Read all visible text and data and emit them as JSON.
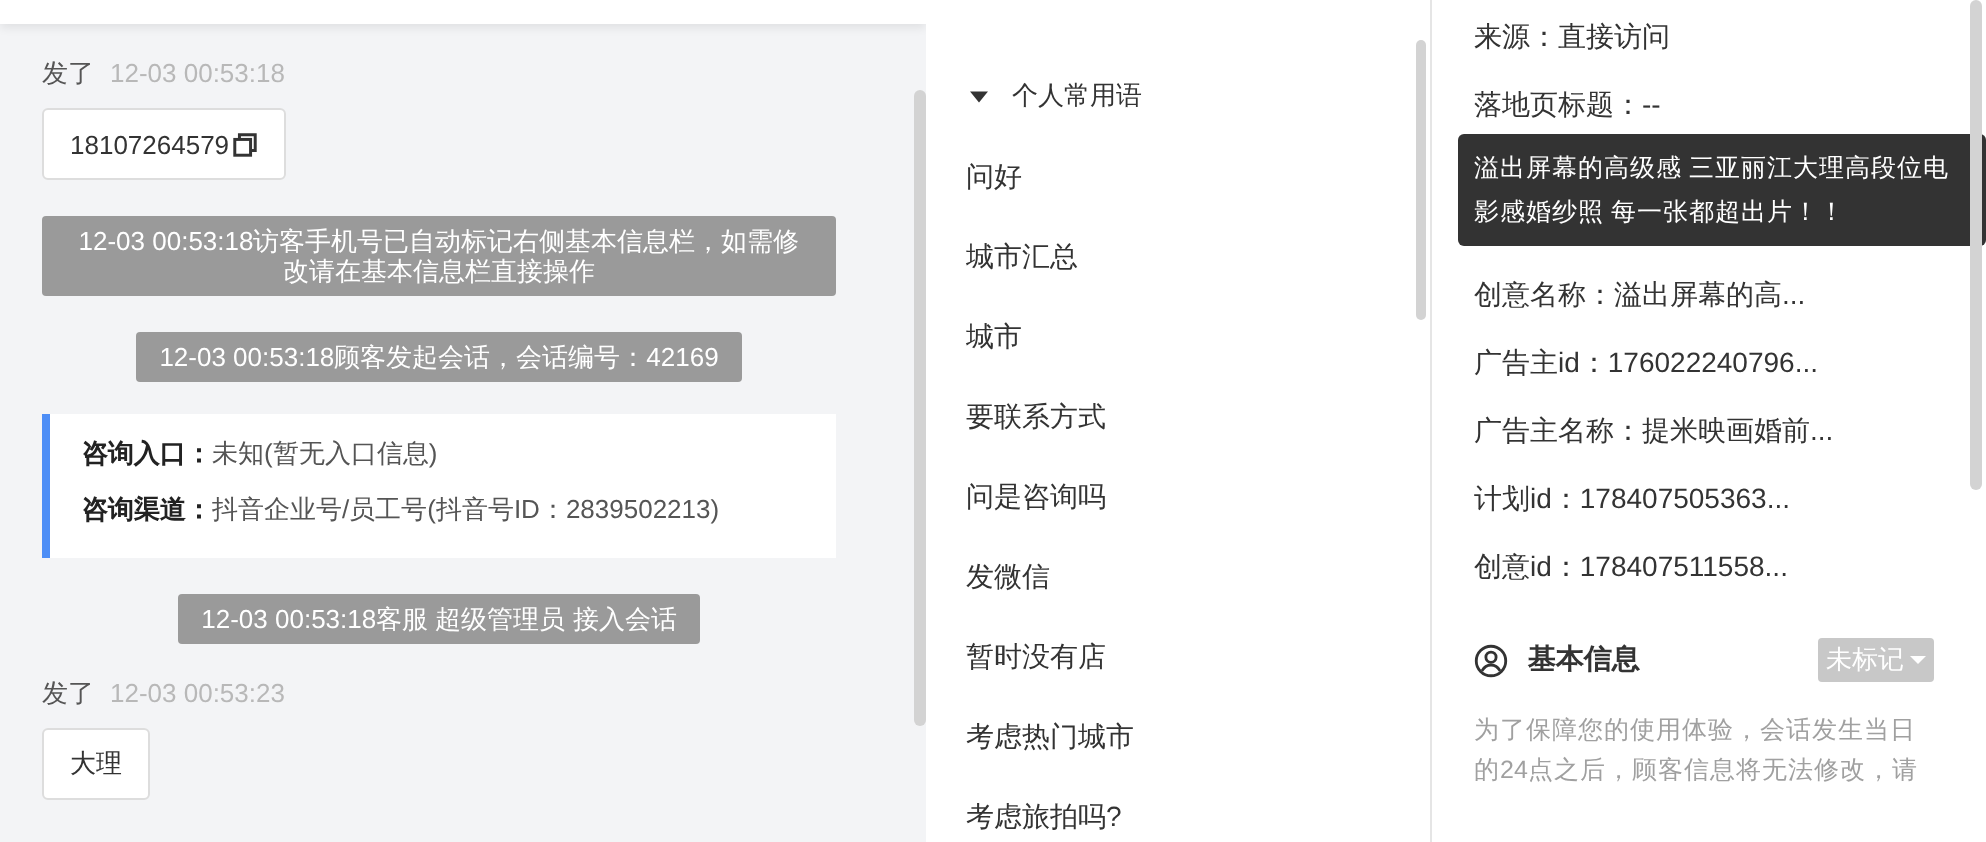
{
  "chat": {
    "messages": [
      {
        "kind": "customer",
        "sender": "发了",
        "time": "12-03 00:53:18",
        "text": "18107264579",
        "copyable": true
      },
      {
        "kind": "system",
        "time": "12-03 00:53:18",
        "text": "访客手机号已自动标记右侧基本信息栏，如需修改请在基本信息栏直接操作"
      },
      {
        "kind": "system",
        "time": "12-03 00:53:18",
        "text": "顾客发起会话，会话编号：42169"
      },
      {
        "kind": "info",
        "rows": [
          {
            "label": "咨询入口：",
            "value": "未知(暂无入口信息)"
          },
          {
            "label": "咨询渠道：",
            "value": "抖音企业号/员工号(抖音号ID：2839502213)"
          }
        ]
      },
      {
        "kind": "system",
        "time": "12-03 00:53:18",
        "text": "客服 超级管理员 接入会话"
      },
      {
        "kind": "customer",
        "sender": "发了",
        "time": "12-03 00:53:23",
        "text": "大理",
        "copyable": false
      }
    ]
  },
  "quick_replies": {
    "group": {
      "title": "个人常用语",
      "expanded": true
    },
    "items": [
      "问好",
      "城市汇总",
      "城市",
      "要联系方式",
      "问是咨询吗",
      "发微信",
      "暂时没有店",
      "考虑热门城市",
      "考虑旅拍吗?"
    ]
  },
  "visitor_info": {
    "fields_top": [
      "来源：直接访问",
      "落地页标题：--"
    ],
    "tooltip": "溢出屏幕的高级感 三亚丽江大理高段位电影感婚纱照 每一张都超出片！！",
    "fields_bottom": [
      "创意名称：溢出屏幕的高...",
      "广告主id：176022240796...",
      "广告主名称：提米映画婚前...",
      "计划id：178407505363...",
      "创意id：178407511558..."
    ],
    "basic_info": {
      "title": "基本信息",
      "tag": "未标记",
      "notice": "为了保障您的使用体验，会话发生当日的24点之后，顾客信息将无法修改，请"
    }
  }
}
